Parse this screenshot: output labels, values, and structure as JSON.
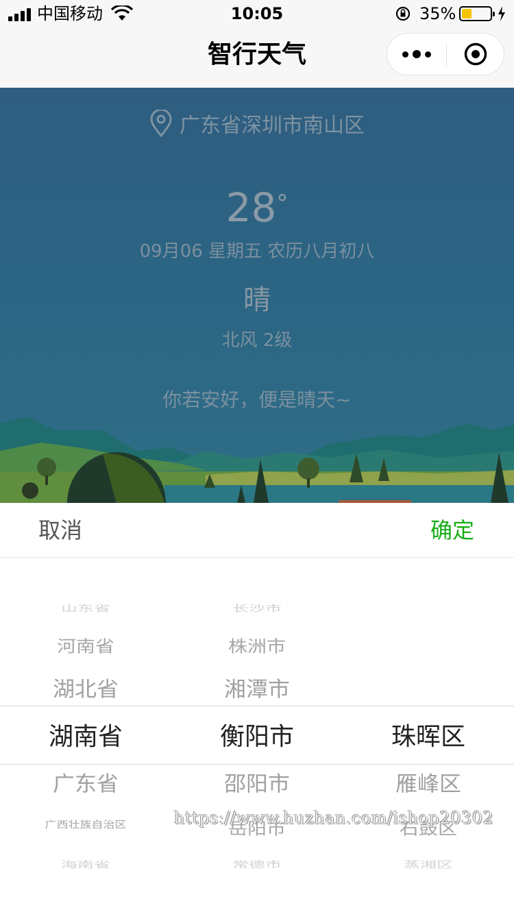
{
  "status_bar": {
    "carrier": "中国移动",
    "time": "10:05",
    "battery_percent_text": "35%",
    "battery_level": 0.35,
    "battery_color": "#f5c400"
  },
  "nav": {
    "title": "智行天气",
    "more_icon": "more-dots-icon",
    "close_icon": "target-close-icon"
  },
  "weather": {
    "location": "广东省深圳市南山区",
    "temperature": "28",
    "degree": "°",
    "date": "09月06 星期五 农历八月初八",
    "condition": "晴",
    "wind": "北风 2级",
    "motto": "你若安好，便是晴天~"
  },
  "picker": {
    "cancel_label": "取消",
    "confirm_label": "确定",
    "confirm_color": "#1aad19",
    "provinces": [
      "山东省",
      "河南省",
      "湖北省",
      "湖南省",
      "广东省",
      "广西壮族自治区",
      "海南省"
    ],
    "cities": [
      "长沙市",
      "株洲市",
      "湘潭市",
      "衡阳市",
      "邵阳市",
      "岳阳市",
      "常德市"
    ],
    "districts": [
      "",
      "",
      "",
      "珠晖区",
      "雁峰区",
      "石鼓区",
      "蒸湘区"
    ]
  },
  "watermark": "https://www.huzhan.com/ishop20302"
}
